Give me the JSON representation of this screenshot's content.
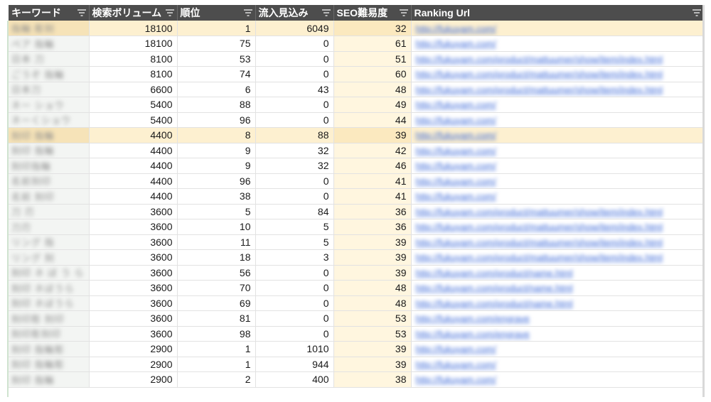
{
  "header": {
    "keyword": "キーワード",
    "volume": "検索ボリューム",
    "rank": "順位",
    "inflow": "流入見込み",
    "seo": "SEO難易度",
    "url": "Ranking Url"
  },
  "colors": {
    "header_bg": "#4d4d4d",
    "highlight_row": "#fdf0d0",
    "link": "#3b68d8"
  },
  "rows": [
    {
      "kw": "指輪 彫刻",
      "vol": "18100",
      "rank": "1",
      "flow": "6049",
      "seo": "32",
      "url": "http://fukuyam.com/",
      "hl": true
    },
    {
      "kw": "ペア 指輪",
      "vol": "18100",
      "rank": "75",
      "flow": "0",
      "seo": "61",
      "url": "http://fukuyam.com/"
    },
    {
      "kw": "日本 刀",
      "vol": "8100",
      "rank": "53",
      "flow": "0",
      "seo": "51",
      "url": "http://fukuyam.com/product/mattuumer/show/item/index.html"
    },
    {
      "kw": "ごうぞ 指輪",
      "vol": "8100",
      "rank": "74",
      "flow": "0",
      "seo": "60",
      "url": "http://fukuyam.com/product/mattuumer/show/item/index.html"
    },
    {
      "kw": "日本刀",
      "vol": "6600",
      "rank": "6",
      "flow": "43",
      "seo": "48",
      "url": "http://fukuyam.com/product/mattuumer/show/item/index.html"
    },
    {
      "kw": "ネー ショウ",
      "vol": "5400",
      "rank": "88",
      "flow": "0",
      "seo": "49",
      "url": "http://fukuyam.com/"
    },
    {
      "kw": "ネーくショウ",
      "vol": "5400",
      "rank": "96",
      "flow": "0",
      "seo": "44",
      "url": "http://fukuyam.com/"
    },
    {
      "kw": "刻印 指輪",
      "vol": "4400",
      "rank": "8",
      "flow": "88",
      "seo": "39",
      "url": "http://fukuyam.com/",
      "hl": true
    },
    {
      "kw": "刻印 指輪",
      "vol": "4400",
      "rank": "9",
      "flow": "32",
      "seo": "42",
      "url": "http://fukuyam.com/"
    },
    {
      "kw": "刻印指輪",
      "vol": "4400",
      "rank": "9",
      "flow": "32",
      "seo": "46",
      "url": "http://fukuyam.com/"
    },
    {
      "kw": "名前刻印",
      "vol": "4400",
      "rank": "96",
      "flow": "0",
      "seo": "41",
      "url": "http://fukuyam.com/"
    },
    {
      "kw": "名前 刻印",
      "vol": "4400",
      "rank": "38",
      "flow": "0",
      "seo": "41",
      "url": "http://fukuyam.com/"
    },
    {
      "kw": "刀 刃",
      "vol": "3600",
      "rank": "5",
      "flow": "84",
      "seo": "36",
      "url": "http://fukuyam.com/product/mattuumer/show/item/index.html"
    },
    {
      "kw": "刀刃",
      "vol": "3600",
      "rank": "10",
      "flow": "5",
      "seo": "36",
      "url": "http://fukuyam.com/product/mattuumer/show/item/index.html"
    },
    {
      "kw": "リング 指",
      "vol": "3600",
      "rank": "11",
      "flow": "5",
      "seo": "39",
      "url": "http://fukuyam.com/product/mattuumer/show/item/index.html"
    },
    {
      "kw": "リング 刻",
      "vol": "3600",
      "rank": "18",
      "flow": "3",
      "seo": "39",
      "url": "http://fukuyam.com/product/mattuumer/show/item/index.html"
    },
    {
      "kw": "刻印 ネ ぼ う ら",
      "vol": "3600",
      "rank": "56",
      "flow": "0",
      "seo": "39",
      "url": "http://fukuyam.com/product/name.html"
    },
    {
      "kw": "刻印 ネぼうら",
      "vol": "3600",
      "rank": "70",
      "flow": "0",
      "seo": "48",
      "url": "http://fukuyam.com/product/name.html"
    },
    {
      "kw": "刻印 ネぼうら",
      "vol": "3600",
      "rank": "69",
      "flow": "0",
      "seo": "48",
      "url": "http://fukuyam.com/product/name.html"
    },
    {
      "kw": "刻印彫 刻印",
      "vol": "3600",
      "rank": "81",
      "flow": "0",
      "seo": "53",
      "url": "http://fukuyam.com/engrave"
    },
    {
      "kw": "刻印彫刻印",
      "vol": "3600",
      "rank": "98",
      "flow": "0",
      "seo": "53",
      "url": "http://fukuyam.com/engrave"
    },
    {
      "kw": "刻印 指輪彫",
      "vol": "2900",
      "rank": "1",
      "flow": "1010",
      "seo": "39",
      "url": "http://fukuyam.com/"
    },
    {
      "kw": "刻印 指輪彫",
      "vol": "2900",
      "rank": "1",
      "flow": "944",
      "seo": "39",
      "url": "http://fukuyam.com/"
    },
    {
      "kw": "刻印 指輪",
      "vol": "2900",
      "rank": "2",
      "flow": "400",
      "seo": "38",
      "url": "http://fukuyam.com/"
    }
  ]
}
